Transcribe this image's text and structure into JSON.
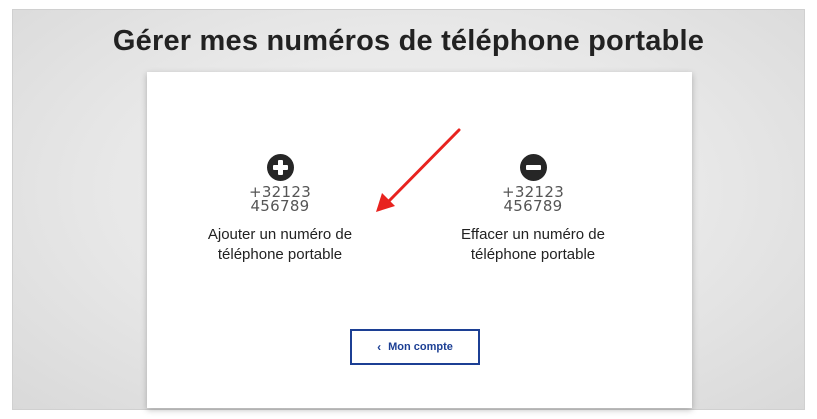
{
  "page": {
    "title": "Gérer mes numéros de téléphone portable"
  },
  "options": {
    "add": {
      "icon": "plus-circle-icon",
      "number_line1": "+32123",
      "number_line2": "456789",
      "label_line1": "Ajouter un numéro de",
      "label_line2": "téléphone portable"
    },
    "remove": {
      "icon": "minus-circle-icon",
      "number_line1": "+32123",
      "number_line2": "456789",
      "label_line1": "Effacer un numéro de",
      "label_line2": "téléphone portable"
    }
  },
  "footer": {
    "back_icon": "chevron-left-icon",
    "back_chevron": "‹",
    "back_label": "Mon compte"
  },
  "annotation": {
    "icon": "red-arrow-icon",
    "color": "#e8231f"
  },
  "colors": {
    "button_border": "#1c3f94",
    "icon_fill": "#262626"
  }
}
